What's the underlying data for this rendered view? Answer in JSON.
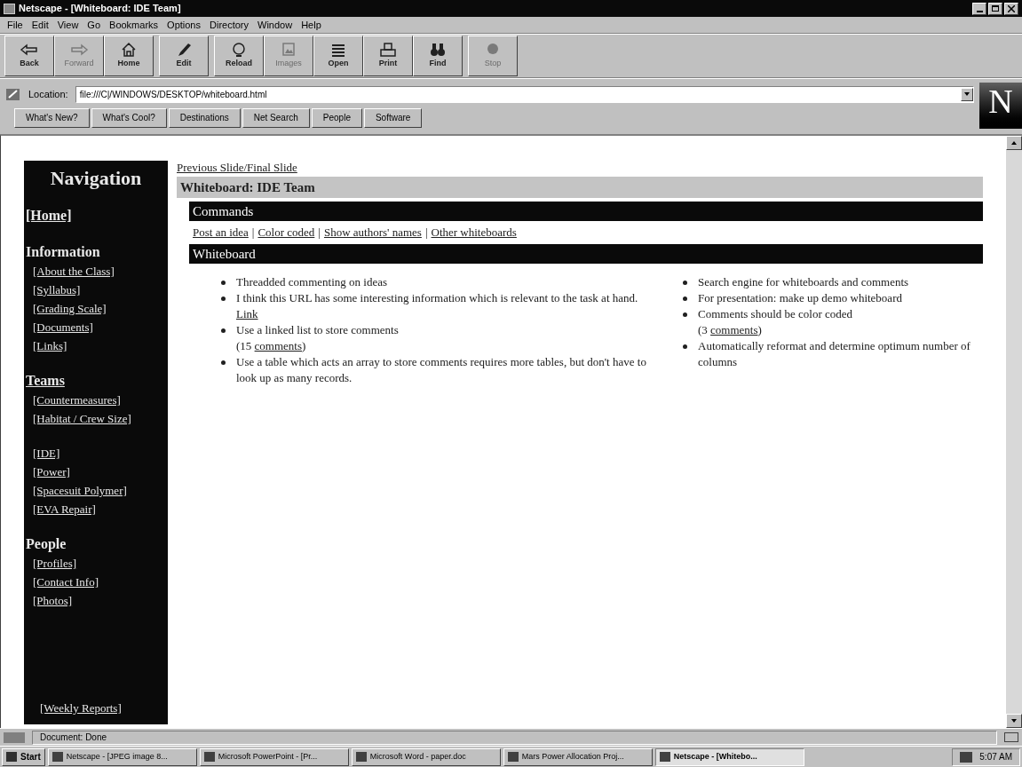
{
  "window": {
    "title": "Netscape - [Whiteboard: IDE Team]"
  },
  "menu": [
    "File",
    "Edit",
    "View",
    "Go",
    "Bookmarks",
    "Options",
    "Directory",
    "Window",
    "Help"
  ],
  "toolbar": [
    {
      "label": "Back",
      "kind": "back",
      "disabled": false
    },
    {
      "label": "Forward",
      "kind": "forward",
      "disabled": true
    },
    {
      "label": "Home",
      "kind": "home",
      "disabled": false
    },
    {
      "label": "Edit",
      "kind": "edit",
      "disabled": false
    },
    {
      "label": "Reload",
      "kind": "reload",
      "disabled": false
    },
    {
      "label": "Images",
      "kind": "images",
      "disabled": true
    },
    {
      "label": "Open",
      "kind": "open",
      "disabled": false
    },
    {
      "label": "Print",
      "kind": "print",
      "disabled": false
    },
    {
      "label": "Find",
      "kind": "find",
      "disabled": false
    },
    {
      "label": "Stop",
      "kind": "stop",
      "disabled": true
    }
  ],
  "location": {
    "label": "Location:",
    "value": "file:///C|/WINDOWS/DESKTOP/whiteboard.html"
  },
  "logo": "N",
  "directory_buttons": [
    "What's New?",
    "What's Cool?",
    "Destinations",
    "Net Search",
    "People",
    "Software"
  ],
  "nav": {
    "title": "Navigation",
    "groups": [
      {
        "kind": "top",
        "items": [
          "[Home]"
        ]
      },
      {
        "heading": "Information",
        "heading_link": false,
        "items": [
          "[About the Class]",
          "[Syllabus]",
          "[Grading Scale]",
          "[Documents]",
          "[Links]"
        ]
      },
      {
        "heading": "Teams",
        "heading_link": true,
        "items": [
          "[Countermeasures]",
          "[Habitat / Crew Size]"
        ]
      },
      {
        "items": [
          "[IDE]",
          "[Power]",
          "[Spacesuit Polymer]",
          "[EVA Repair]"
        ]
      },
      {
        "heading": "People",
        "heading_link": false,
        "items": [
          "[Profiles]",
          "[Contact Info]",
          "[Photos]"
        ]
      },
      {
        "kind": "bottom",
        "items": [
          "[Weekly Reports]"
        ]
      }
    ]
  },
  "page": {
    "prev_link": "Previous Slide/Final Slide",
    "title": "Whiteboard: IDE Team",
    "commands": {
      "heading": "Commands",
      "separator": "|",
      "links": [
        "Post an idea",
        "Color coded",
        "Show authors' names",
        "Other whiteboards"
      ]
    },
    "whiteboard": {
      "heading": "Whiteboard",
      "columns": [
        [
          {
            "text": "Threadded commenting on ideas"
          },
          {
            "text": "I think this URL has some interesting information which is relevant to the task at hand.",
            "link": "Link"
          },
          {
            "text": "Use a linked list to store comments",
            "comments": {
              "before": "(15 ",
              "link": "comments",
              "after": ")"
            }
          },
          {
            "text": "Use a table which acts an array to store comments requires more tables, but don't have to look up as many records."
          }
        ],
        [
          {
            "text": "Search engine for whiteboards and comments"
          },
          {
            "text": "For presentation: make up demo whiteboard"
          },
          {
            "text": "Comments should be color coded",
            "comments": {
              "before": "(3 ",
              "link": "comments",
              "after": ")"
            }
          },
          {
            "text": "Automatically reformat and determine optimum number of columns"
          }
        ]
      ]
    }
  },
  "status_bar": {
    "text": "Document: Done"
  },
  "taskbar": {
    "start": "Start",
    "tasks": [
      {
        "label": "Netscape - [JPEG image 8...",
        "selected": false
      },
      {
        "label": "Microsoft PowerPoint - [Pr...",
        "selected": false
      },
      {
        "label": "Microsoft Word - paper.doc",
        "selected": false
      },
      {
        "label": "Mars Power Allocation Proj...",
        "selected": false
      },
      {
        "label": "Netscape - [Whitebo...",
        "selected": true
      }
    ],
    "clock": "5:07 AM"
  }
}
